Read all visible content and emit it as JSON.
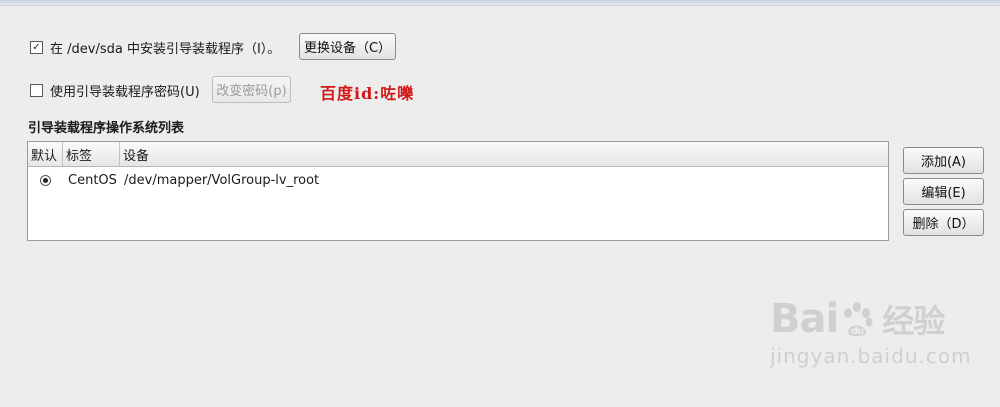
{
  "install_loader": {
    "checked": true,
    "check_glyph": "✓",
    "label": "在 /dev/sda 中安装引导装载程序（I）。",
    "change_device_label": "更换设备（C）"
  },
  "loader_password": {
    "checked": false,
    "label": "使用引导装载程序密码(U)",
    "change_password_label": "改变密码(p)"
  },
  "overlay_text": "百度id:咗嚛",
  "os_list": {
    "title": "引导装载程序操作系统列表",
    "columns": [
      "默认",
      "标签",
      "设备"
    ],
    "rows": [
      {
        "default": true,
        "label": "CentOS",
        "device": "/dev/mapper/VolGroup-lv_root"
      }
    ]
  },
  "actions": {
    "add_label": "添加(A)",
    "edit_label": "编辑(E)",
    "delete_label": "删除（D）"
  },
  "watermark": {
    "logo_left": "Bai",
    "logo_right": "经验",
    "url": "jingyan.baidu.com"
  },
  "colors": {
    "overlay_red": "#d01818",
    "watermark_gray": "#d0d0d0",
    "background": "#ededed"
  }
}
